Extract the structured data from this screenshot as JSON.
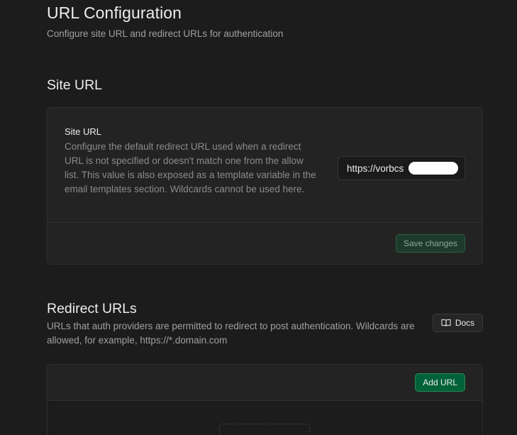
{
  "header": {
    "title": "URL Configuration",
    "subtitle": "Configure site URL and redirect URLs for authentication"
  },
  "site_url": {
    "section_title": "Site URL",
    "field_label": "Site URL",
    "description": "Configure the default redirect URL used when a redirect URL is not specified or doesn't match one from the allow list. This value is also exposed as a template variable in the email templates section. Wildcards cannot be used here.",
    "input_value": "https://vorbcs",
    "save_label": "Save changes"
  },
  "redirect_urls": {
    "section_title": "Redirect URLs",
    "description": "URLs that auth providers are permitted to redirect to post authentication. Wildcards are allowed, for example, https://*.domain.com",
    "docs_label": "Docs",
    "docs_icon": "book-icon",
    "add_label": "Add URL"
  },
  "colors": {
    "background": "#1c1c1c",
    "card": "#232323",
    "accent_green": "#006239",
    "muted_text": "#8b8b8b"
  }
}
